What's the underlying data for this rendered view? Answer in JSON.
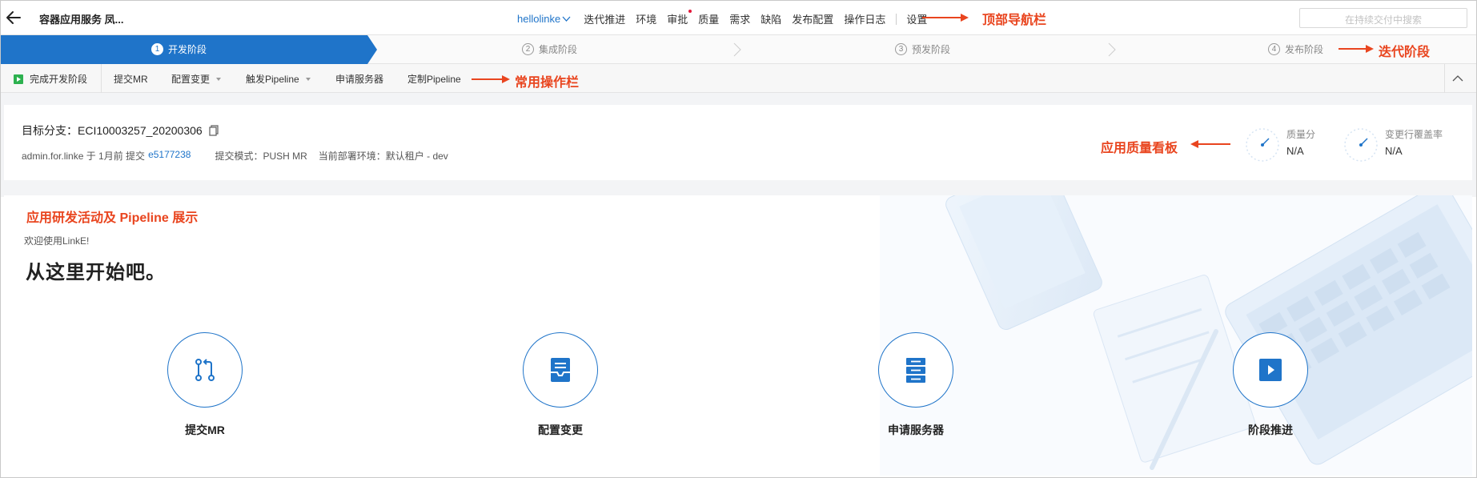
{
  "header": {
    "app_title": "容器应用服务 凤...",
    "app_selector": "hellolinke",
    "nav_items": [
      "迭代推进",
      "环境",
      "审批",
      "质量",
      "需求",
      "缺陷",
      "发布配置",
      "操作日志"
    ],
    "settings": "设置",
    "search_placeholder": "在持续交付中搜索"
  },
  "steps": [
    {
      "num": "1",
      "label": "开发阶段",
      "active": true
    },
    {
      "num": "2",
      "label": "集成阶段",
      "active": false
    },
    {
      "num": "3",
      "label": "预发阶段",
      "active": false
    },
    {
      "num": "4",
      "label": "发布阶段",
      "active": false
    }
  ],
  "toolbar": {
    "complete": "完成开发阶段",
    "submit_mr": "提交MR",
    "config_change": "配置变更",
    "trigger_pipeline": "触发Pipeline",
    "apply_server": "申请服务器",
    "custom_pipeline": "定制Pipeline"
  },
  "branch": {
    "title": "目标分支：ECI10003257_20200306",
    "commit_prefix": "admin.for.linke 于 1月前 提交",
    "commit_hash": "e5177238",
    "submit_mode": "提交模式：PUSH MR",
    "deploy_env": "当前部署环境：默认租户 - dev"
  },
  "metrics": [
    {
      "label": "质量分",
      "value": "N/A"
    },
    {
      "label": "变更行覆盖率",
      "value": "N/A"
    }
  ],
  "activity": {
    "welcome_small": "欢迎使用LinkE!",
    "welcome_big": "从这里开始吧。",
    "actions": [
      {
        "label": "提交MR",
        "icon": "merge-request-icon"
      },
      {
        "label": "配置变更",
        "icon": "config-tray-icon"
      },
      {
        "label": "申请服务器",
        "icon": "server-icon"
      },
      {
        "label": "阶段推进",
        "icon": "play-icon"
      }
    ]
  },
  "annotations": {
    "top_nav": "顶部导航栏",
    "iteration_stage": "迭代阶段",
    "common_ops": "常用操作栏",
    "quality_board": "应用质量看板",
    "activity_pipeline": "应用研发活动及 Pipeline 展示"
  },
  "colors": {
    "primary": "#1f74c9",
    "annotation": "#e9451f",
    "green": "#2db14f",
    "badge_dot": "#e4183a"
  }
}
